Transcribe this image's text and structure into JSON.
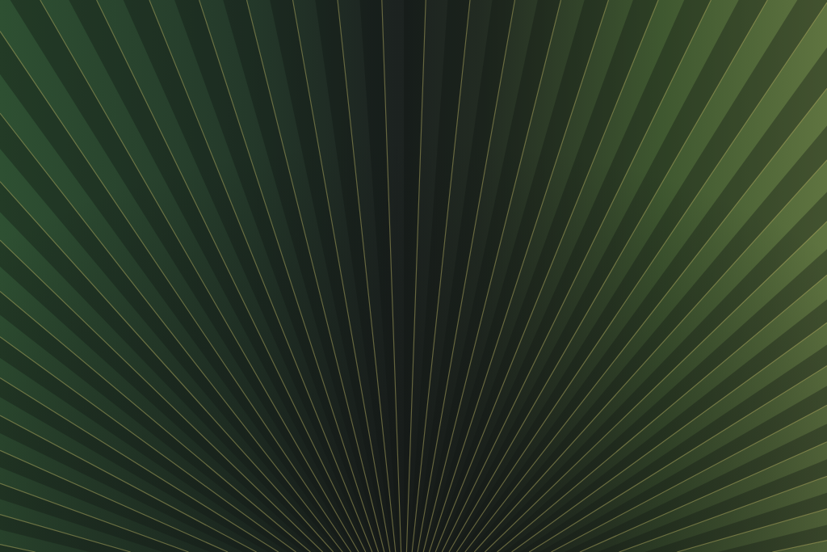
{
  "photo": {
    "kind": "photo"
  }
}
